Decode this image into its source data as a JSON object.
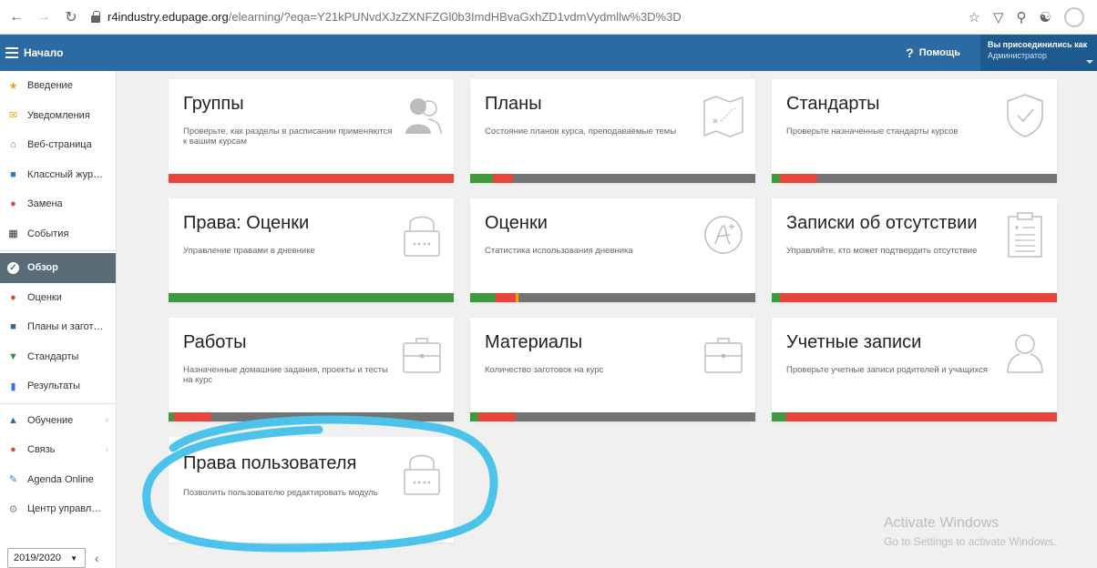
{
  "browser": {
    "url_domain": "r4industry.edupage.org",
    "url_path": "/elearning/?eqa=Y21kPUNvdXJzZXNFZGl0b3ImdHBvaGxhZD1vdmVydmllw%3D%3D"
  },
  "topbar": {
    "home_label": "Начало",
    "help_label": "Помощь",
    "user_line1": "Вы присоединились как",
    "user_line2": "Администратор"
  },
  "sidebar": {
    "items": [
      {
        "label": "Введение",
        "icon": "star-icon",
        "color": "#f5a100"
      },
      {
        "label": "Уведомления",
        "icon": "envelope-icon",
        "color": "#f5a100"
      },
      {
        "label": "Веб-страница",
        "icon": "home-icon",
        "color": "#2e9a4e"
      },
      {
        "label": "Классный жур…",
        "icon": "journal-icon",
        "color": "#2b7bd4"
      },
      {
        "label": "Замена",
        "icon": "person-icon",
        "color": "#e8453c"
      },
      {
        "label": "События",
        "icon": "calendar-icon",
        "color": "#333333"
      },
      {
        "label": "Обзор",
        "icon": "check-icon",
        "color": "#ffffff"
      },
      {
        "label": "Оценки",
        "icon": "grade-icon",
        "color": "#e8453c"
      },
      {
        "label": "Планы и загот…",
        "icon": "briefcase-icon",
        "color": "#2b6aa3"
      },
      {
        "label": "Стандарты",
        "icon": "shield-icon",
        "color": "#2e9a4e"
      },
      {
        "label": "Результаты",
        "icon": "bar-chart-icon",
        "color": "#2b7bd4"
      },
      {
        "label": "Обучение",
        "icon": "school-icon",
        "color": "#2b6aa3"
      },
      {
        "label": "Связь",
        "icon": "chat-icon",
        "color": "#e8453c"
      },
      {
        "label": "Agenda Online",
        "icon": "pen-icon",
        "color": "#2b7bd4"
      },
      {
        "label": "Центр управл…",
        "icon": "gear-icon",
        "color": "#888888"
      }
    ],
    "year": "2019/2020"
  },
  "cards": [
    {
      "title": "Группы",
      "desc": "Проверьте, как разделы в расписании применяются к вашим курсам",
      "icon": "users-icon",
      "bar": [
        [
          "red",
          100
        ]
      ]
    },
    {
      "title": "Планы",
      "desc": "Состояние планов курса, преподаваемые темы",
      "icon": "map-icon",
      "bar": [
        [
          "green",
          8
        ],
        [
          "red",
          7
        ],
        [
          "gray",
          85
        ]
      ]
    },
    {
      "title": "Стандарты",
      "desc": "Проверьте назначенные стандарты курсов",
      "icon": "shield-check-icon",
      "bar": [
        [
          "green",
          3
        ],
        [
          "red",
          13
        ],
        [
          "gray",
          84
        ]
      ]
    },
    {
      "title": "Права: Оценки",
      "desc": "Управление правами в дневнике",
      "icon": "lock-icon",
      "bar": [
        [
          "green",
          100
        ]
      ]
    },
    {
      "title": "Оценки",
      "desc": "Статистика использования дневника",
      "icon": "grade-circle-icon",
      "bar": [
        [
          "green",
          9
        ],
        [
          "red",
          7
        ],
        [
          "orange",
          1
        ],
        [
          "gray",
          83
        ]
      ]
    },
    {
      "title": "Записки об отсутствии",
      "desc": "Управляйте, кто может подтвердить отсутствие",
      "icon": "clipboard-icon",
      "bar": [
        [
          "green",
          3
        ],
        [
          "red",
          97
        ]
      ]
    },
    {
      "title": "Работы",
      "desc": "Назначенные домашние задания, проекты и тесты на курс",
      "icon": "briefcase-outline-icon",
      "bar": [
        [
          "green",
          2
        ],
        [
          "red",
          13
        ],
        [
          "gray",
          85
        ]
      ]
    },
    {
      "title": "Материалы",
      "desc": "Количество заготовок на курс",
      "icon": "briefcase-outline-icon",
      "bar": [
        [
          "green",
          3
        ],
        [
          "red",
          13
        ],
        [
          "gray",
          84
        ]
      ]
    },
    {
      "title": "Учетные записи",
      "desc": "Проверьте учетные записи родителей и учащихся",
      "icon": "user-outline-icon",
      "bar": [
        [
          "green",
          5
        ],
        [
          "red",
          95
        ]
      ]
    },
    {
      "title": "Права пользователя",
      "desc": "Позволить пользователю редактировать модуль",
      "icon": "lock-icon",
      "bar": []
    }
  ],
  "watermark": {
    "line1": "Activate Windows",
    "line2": "Go to Settings to activate Windows."
  },
  "colors": {
    "topbar": "#2b6aa3",
    "green": "#3d9a3d",
    "red": "#e8453c",
    "gray": "#737373",
    "highlight": "#4cc3ea"
  }
}
